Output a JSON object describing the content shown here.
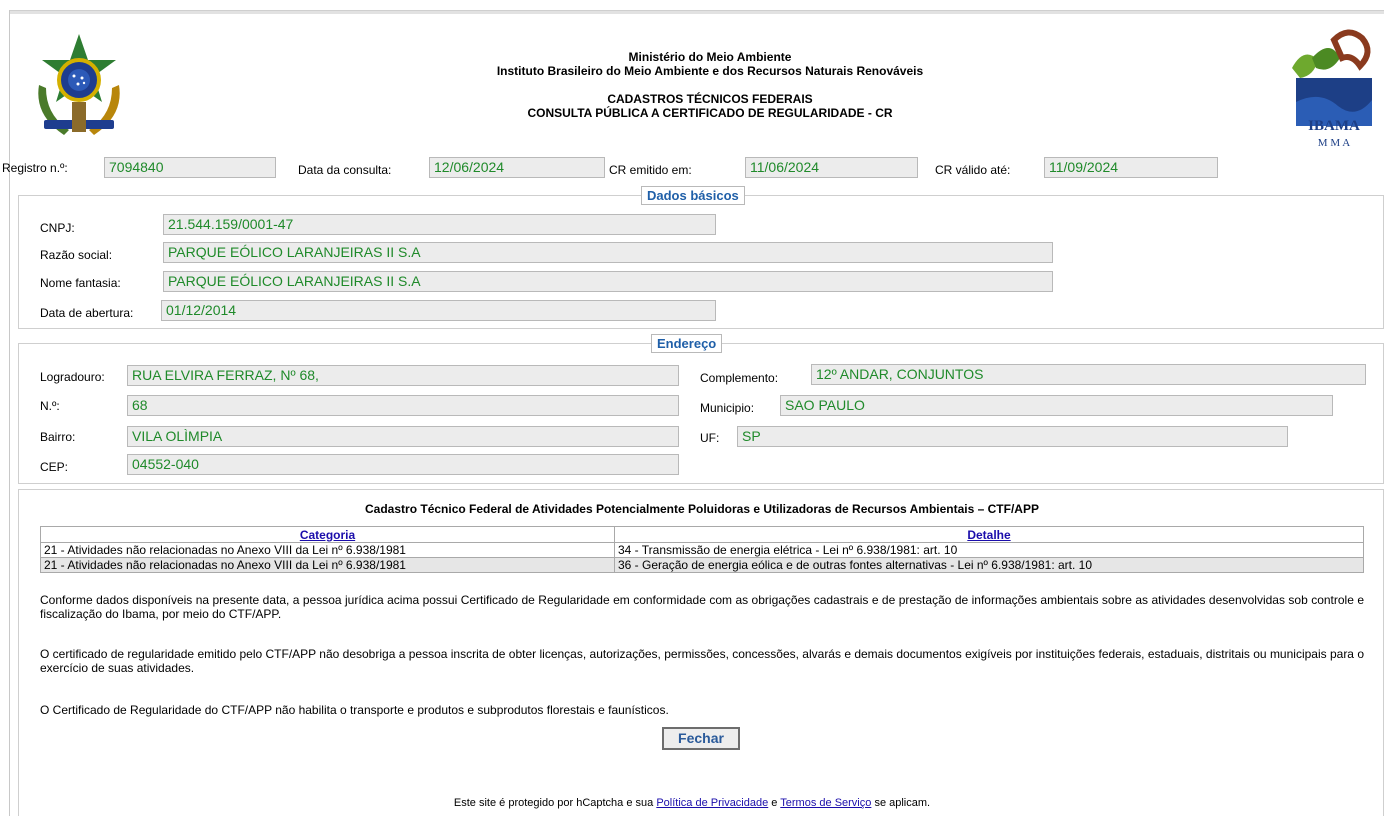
{
  "header": {
    "line1": "Ministério do Meio Ambiente",
    "line2": "Instituto Brasileiro do Meio Ambiente e dos Recursos Naturais Renováveis",
    "line3": "CADASTROS TÉCNICOS FEDERAIS",
    "line4": "CONSULTA PÚBLICA A CERTIFICADO DE REGULARIDADE - CR",
    "logo_text": "IBAMA",
    "logo_subtext": "M M A"
  },
  "registro": {
    "registro_label": "Registro n.º:",
    "registro_value": "7094840",
    "data_consulta_label": "Data da consulta:",
    "data_consulta_value": "12/06/2024",
    "cr_emitido_label": "CR emitido em:",
    "cr_emitido_value": "11/06/2024",
    "cr_valido_label": "CR válido até:",
    "cr_valido_value": "11/09/2024"
  },
  "dados_basicos": {
    "legend": "Dados básicos",
    "cnpj_label": "CNPJ:",
    "cnpj_value": "21.544.159/0001-47",
    "razao_label": "Razão social:",
    "razao_value": "PARQUE EÓLICO LARANJEIRAS II S.A",
    "fantasia_label": "Nome fantasia:",
    "fantasia_value": "PARQUE EÓLICO LARANJEIRAS II S.A",
    "abertura_label": "Data de abertura:",
    "abertura_value": "01/12/2014"
  },
  "endereco": {
    "legend": "Endereço",
    "logradouro_label": "Logradouro:",
    "logradouro_value": "RUA ELVIRA FERRAZ, Nº 68,",
    "numero_label": "N.º:",
    "numero_value": "68",
    "bairro_label": "Bairro:",
    "bairro_value": "VILA OLÌMPIA",
    "cep_label": "CEP:",
    "cep_value": "04552-040",
    "complemento_label": "Complemento:",
    "complemento_value": "12º ANDAR, CONJUNTOS",
    "municipio_label": "Municipio:",
    "municipio_value": "SAO PAULO",
    "uf_label": "UF:",
    "uf_value": "SP"
  },
  "ctf": {
    "title": "Cadastro Técnico Federal de Atividades Potencialmente Poluidoras e Utilizadoras de Recursos Ambientais – CTF/APP",
    "col_categoria": "Categoria",
    "col_detalhe": "Detalhe",
    "rows": [
      {
        "categoria": "21 - Atividades não relacionadas no Anexo VIII da Lei nº 6.938/1981",
        "detalhe": "34 - Transmissão de energia elétrica - Lei nº 6.938/1981: art. 10"
      },
      {
        "categoria": "21 - Atividades não relacionadas no Anexo VIII da Lei nº 6.938/1981",
        "detalhe": "36 - Geração de energia eólica e de outras fontes alternativas - Lei nº 6.938/1981: art. 10"
      }
    ]
  },
  "text": {
    "para1": "Conforme dados disponíveis na presente data, a pessoa jurídica acima possui Certificado de Regularidade em conformidade com as obrigações cadastrais e de prestação de informações ambientais sobre as atividades desenvolvidas sob controle e fiscalização do Ibama, por meio do CTF/APP.",
    "para2": "O certificado de regularidade emitido pelo CTF/APP não desobriga a pessoa inscrita de obter licenças, autorizações, permissões, concessões, alvarás e demais documentos exigíveis por instituições federais, estaduais, distritais ou municipais para o exercício de suas atividades.",
    "para3": "O Certificado de Regularidade do CTF/APP não habilita o transporte e produtos e subprodutos florestais e faunísticos."
  },
  "actions": {
    "fechar_label": "Fechar"
  },
  "footer": {
    "prefix": "Este site é protegido por hCaptcha e sua",
    "privacy_link": "Política de Privacidade",
    "conj": "e",
    "terms_link": "Termos de Serviço",
    "suffix": "se aplicam."
  },
  "colors": {
    "field_text": "#1f8a2a",
    "legend_text": "#1f5fa8",
    "link": "#1a0dab"
  },
  "icons": {
    "crest": "brazil-coat-of-arms-icon",
    "logo": "ibama-logo-icon"
  }
}
